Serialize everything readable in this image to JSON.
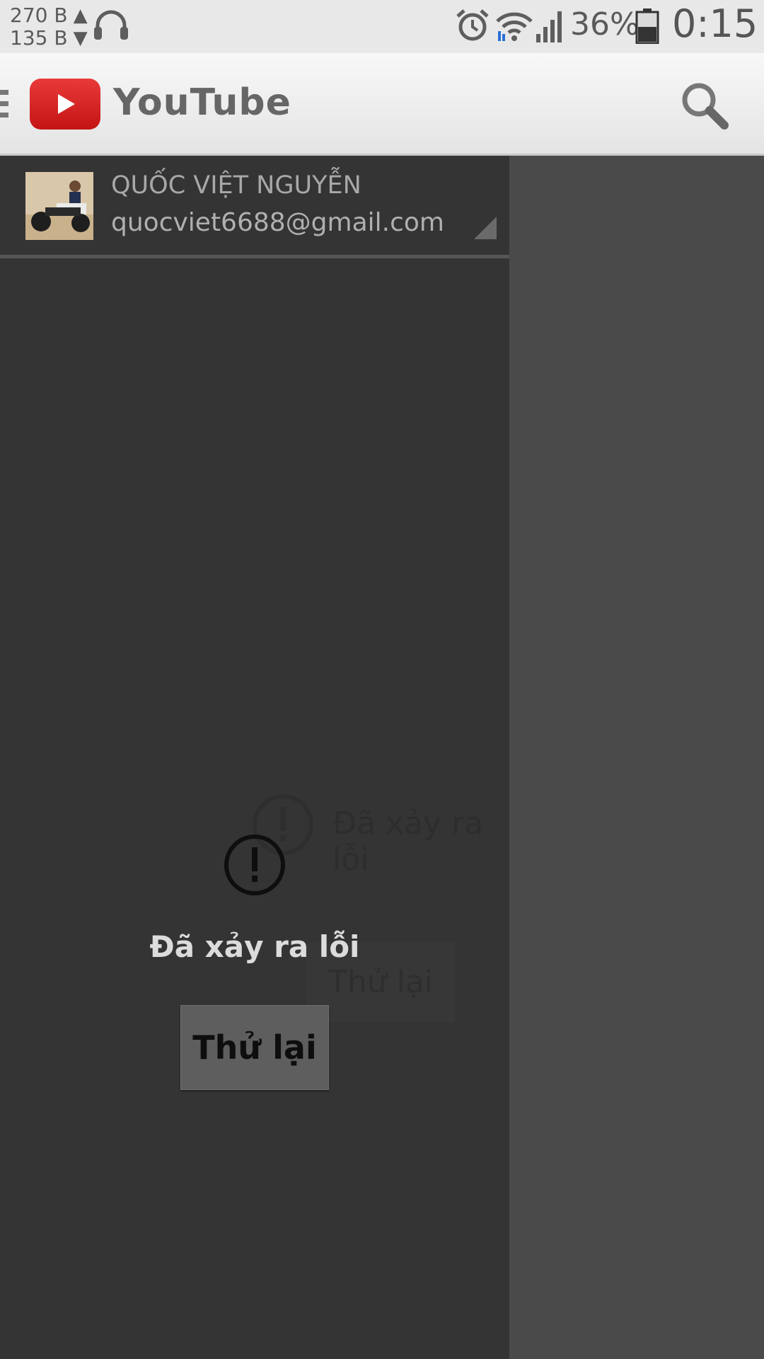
{
  "status_bar": {
    "upload_speed": "270 B",
    "download_speed": "135 B",
    "battery_percent": "36%",
    "time": "0:15",
    "icons": [
      "headphones-icon",
      "alarm-icon",
      "wifi-icon",
      "signal-icon",
      "battery-icon"
    ]
  },
  "app_bar": {
    "title": "YouTube",
    "brand_color": "#e32424"
  },
  "drawer": {
    "account_name": "QUỐC VIỆT NGUYỄN",
    "account_email": "quocviet6688@gmail.com"
  },
  "error": {
    "message": "Đã xảy ra lỗi",
    "retry_label": "Thử lại"
  }
}
